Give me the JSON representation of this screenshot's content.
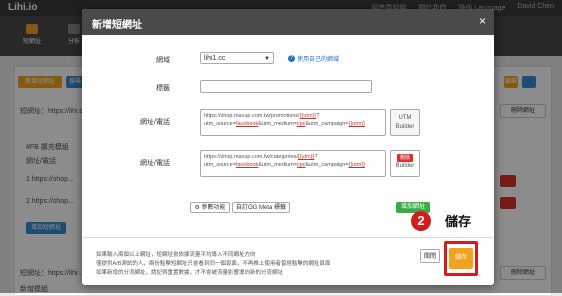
{
  "app": {
    "logo": "Lihi.io",
    "top_links": [
      "回首頁說明",
      "關於我們",
      "操作 Language",
      "David Chen"
    ],
    "nav_tabs": [
      "短網址",
      "分析"
    ],
    "bg_buttons": [
      "新增短網址",
      "搜尋"
    ],
    "bg_right_buttons": [
      "編輯",
      "刪除網址"
    ],
    "bg_labels": [
      "短網址：https://lihi.cc/...",
      "#FB 擴充模組",
      "網址/電話",
      "1  https://shop...",
      "2  https://shop...",
      "增加短網址",
      "短網址：https://lihi...",
      "新增模組"
    ]
  },
  "modal": {
    "title": "新增短網址",
    "close_label": "×",
    "domain_label": "網域",
    "domain_value": "lihi1.cc",
    "domain_help": "使用自己的網域",
    "tag_label": "標籤",
    "tag_value": "",
    "url1_label": "網址/電話",
    "url1_prefix": "https://shop.macup.com.tw/promotions/",
    "url1_source_key": "?utm_source=",
    "url1_source_val": "facebook",
    "url1_medium_key": "&utm_medium=",
    "url1_medium_val": "cpc",
    "url1_campaign_key": "&utm_campaign=",
    "url1_campaign_val": "{{utm}}",
    "utm_builder_label": "UTM Builder",
    "url2_label": "網址/電話",
    "url2_prefix": "https://shop.macup.com.tw/categories/",
    "url2_source_key": "?utm_source=",
    "url2_source_val": "facebook",
    "url2_medium_key": "&utm_medium=",
    "url2_medium_val": "cpc",
    "url2_campaign_key": "&utm_campaign=",
    "url2_campaign_val": "{{utm}}",
    "delete_label": "刪除",
    "builder_label": "Builder",
    "params_button": "參數功能",
    "og_button": "自訂OG Meta 標籤",
    "add_url_button": "增加網址",
    "notes": [
      "如果輸入兩個以上網址，短網址會依據流量平均導入不同網址方向",
      "僅提供A/B測試的人，兩份點擊短網址只會看到同一個頁面，不再推上使用者曾經點擊的網址頁面",
      "如果新增的分流網址，請記得重置數據，才不會被流量影響導向新的分流網址"
    ],
    "cancel_button": "關閉",
    "save_button": "儲存"
  },
  "annotation": {
    "step_number": "2",
    "step_label": "儲存"
  },
  "colors": {
    "header": "#4a4a4a",
    "save": "#f2a21e",
    "highlight": "#d51c1c",
    "add_button": "#3daa4a",
    "link": "#2a6fc9"
  }
}
